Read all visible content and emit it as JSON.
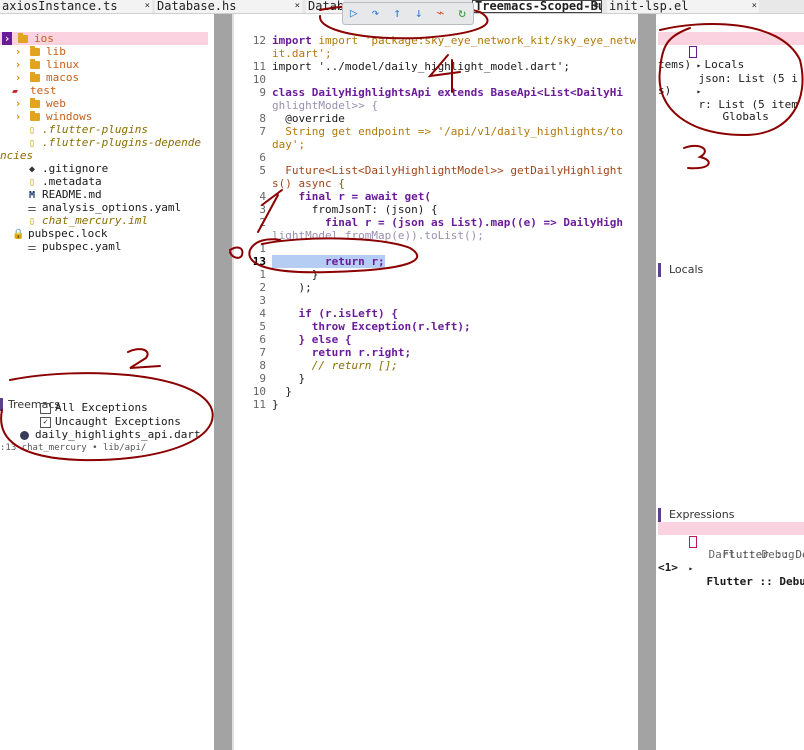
{
  "tabs": [
    {
      "label": "axiosInstance.ts",
      "close": "×"
    },
    {
      "label": "Database.hs",
      "close": "×"
    },
    {
      "label": "Datab",
      "close": ""
    },
    {
      "label": "Treemacs-Scoped-Bu",
      "close": "×"
    },
    {
      "label": "init-lsp.el",
      "close": "×"
    }
  ],
  "toolbar": {
    "continue": "▷",
    "step_over": "↷",
    "step_out": "↑",
    "step_in": "↓",
    "disconnect": "⌁",
    "restart": "↻"
  },
  "tree": {
    "items": [
      {
        "name": "ios",
        "kind": "folder"
      },
      {
        "name": "lib",
        "kind": "folder"
      },
      {
        "name": "linux",
        "kind": "folder"
      },
      {
        "name": "macos",
        "kind": "folder"
      },
      {
        "name": "test",
        "kind": "folder-open"
      },
      {
        "name": "web",
        "kind": "folder"
      },
      {
        "name": "windows",
        "kind": "folder"
      },
      {
        "name": ".flutter-plugins",
        "kind": "file-italic"
      },
      {
        "name": ".flutter-plugins-depende",
        "kind": "file-italic"
      },
      {
        "name": "ncies",
        "kind": "wrap"
      },
      {
        "name": ".gitignore",
        "kind": "file"
      },
      {
        "name": ".metadata",
        "kind": "file"
      },
      {
        "name": "README.md",
        "kind": "file"
      },
      {
        "name": "analysis_options.yaml",
        "kind": "file"
      },
      {
        "name": "chat_mercury.iml",
        "kind": "file-italic"
      },
      {
        "name": "pubspec.lock",
        "kind": "lock"
      },
      {
        "name": "pubspec.yaml",
        "kind": "file"
      }
    ]
  },
  "breakpoints": {
    "header": "Treemacs",
    "all_exceptions": "All Exceptions",
    "uncaught_exceptions": "Uncaught Exceptions",
    "file": "daily_highlights_api.dart",
    "location_line": ":13",
    "location": "chat_mercury • lib/api/"
  },
  "editor": {
    "lines": [
      {
        "n": "12",
        "t": "import 'package:sky_eye_network_kit/sky_eye_network_k"
      },
      {
        "n": "",
        "t": "it.dart';"
      },
      {
        "n": "11",
        "t": "import '../model/daily_highlight_model.dart';"
      },
      {
        "n": "10",
        "t": ""
      },
      {
        "n": "9",
        "t": "class DailyHighlightsApi extends BaseApi<List<DailyHi"
      },
      {
        "n": "",
        "t": "ghlightModel>> {"
      },
      {
        "n": "8",
        "t": "  @override"
      },
      {
        "n": "7",
        "t": "  String get endpoint => '/api/v1/daily_highlights/to"
      },
      {
        "n": "",
        "t": "day';"
      },
      {
        "n": "6",
        "t": ""
      },
      {
        "n": "5",
        "t": "  Future<List<DailyHighlightModel>> getDailyHighlight"
      },
      {
        "n": "",
        "t": "s() async {"
      },
      {
        "n": "4",
        "t": "    final r = await get("
      },
      {
        "n": "3",
        "t": "      fromJsonT: (json) {"
      },
      {
        "n": "2",
        "t": "        final r = (json as List).map((e) => DailyHigh"
      },
      {
        "n": "",
        "t": "lightModel.fromMap(e)).toList();"
      },
      {
        "n": "1",
        "t": ""
      },
      {
        "n": "13",
        "t": "        return r;"
      },
      {
        "n": "1",
        "t": "      }"
      },
      {
        "n": "2",
        "t": "    );"
      },
      {
        "n": "3",
        "t": ""
      },
      {
        "n": "4",
        "t": "    if (r.isLeft) {"
      },
      {
        "n": "5",
        "t": "      throw Exception(r.left);"
      },
      {
        "n": "6",
        "t": "    } else {"
      },
      {
        "n": "7",
        "t": "      return r.right;"
      },
      {
        "n": "8",
        "t": "      // return [];"
      },
      {
        "n": "9",
        "t": "    }"
      },
      {
        "n": "10",
        "t": "  }"
      },
      {
        "n": "11",
        "t": "}"
      }
    ]
  },
  "locals_top": {
    "header": "Locals",
    "json": "json: List (5 i",
    "json_wrap": "tems)",
    "r": "r: List (5 item",
    "r_wrap": "s)",
    "globals": "Globals"
  },
  "locals_panel": {
    "header": "Locals"
  },
  "expressions": {
    "header": "Expressions",
    "items": [
      "Dart :: Debug",
      "Flutter :: Debug",
      "Flutter :: Debug"
    ],
    "footer": "<1>"
  },
  "colors": {
    "selection": "#fbd3e0",
    "current_line": "#b5cdf2",
    "folder": "#e2a31f",
    "keyword": "#6a1b9a",
    "string": "#b0780a",
    "annotation_red": "#8b0000"
  }
}
